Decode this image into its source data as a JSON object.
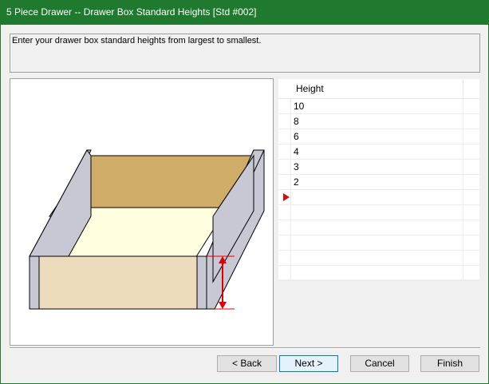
{
  "window": {
    "title": "5 Piece Drawer -- Drawer Box Standard Heights [Std #002]"
  },
  "instructions": "Enter your drawer box standard heights from largest to smallest.",
  "grid": {
    "header": "Height",
    "rows": [
      "10",
      "8",
      "6",
      "4",
      "3",
      "2"
    ]
  },
  "buttons": {
    "back": "< Back",
    "next": "Next >",
    "cancel": "Cancel",
    "finish": "Finish"
  },
  "colors": {
    "titlebar": "#1f7a2f",
    "dimension_marker": "#e00000",
    "drawer_front": "#ecdcbc",
    "drawer_back_panel": "#cfac68",
    "drawer_floor": "#ffffe0",
    "drawer_sides": "#c8c8d4"
  }
}
